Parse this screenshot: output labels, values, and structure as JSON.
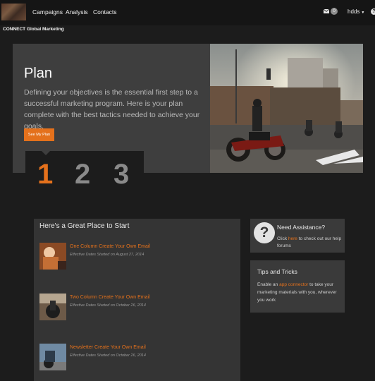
{
  "nav": {
    "items": [
      {
        "label": "Campaigns"
      },
      {
        "label": "Analysis"
      },
      {
        "label": "Contacts"
      }
    ],
    "mail_count": "0",
    "user": "hdds",
    "company": "CONNECT Global Marketing"
  },
  "hero": {
    "title": "Plan",
    "description": "Defining your objectives is the essential first step to a successful marketing program. Here is your plan complete with the best tactics needed to achieve your goals.",
    "button_label": "See My Plan",
    "steps": [
      "1",
      "2",
      "3"
    ],
    "active_step": "1"
  },
  "start": {
    "title": "Here's a Great Place to Start",
    "items": [
      {
        "title": "One Column Create Your Own Email",
        "meta": "Effective Dates Started on August 27, 2014"
      },
      {
        "title": "Two Column Create Your Own Email",
        "meta": "Effective Dates Started on October 26, 2014"
      },
      {
        "title": "Newsletter Create Your Own Email",
        "meta": "Effective Dates Started on October 26, 2014"
      }
    ]
  },
  "assistance": {
    "title": "Need Assistance?",
    "text_before": "Click ",
    "link": "here",
    "text_after": " to check out our help forums"
  },
  "tips": {
    "title": "Tips and Tricks",
    "text_before": "Enable an ",
    "link": "app connector",
    "text_after": " to take your marketing materials with you, wherever you work"
  },
  "colors": {
    "accent": "#e4711c",
    "background": "#1c1c1c",
    "panel": "#343434"
  }
}
